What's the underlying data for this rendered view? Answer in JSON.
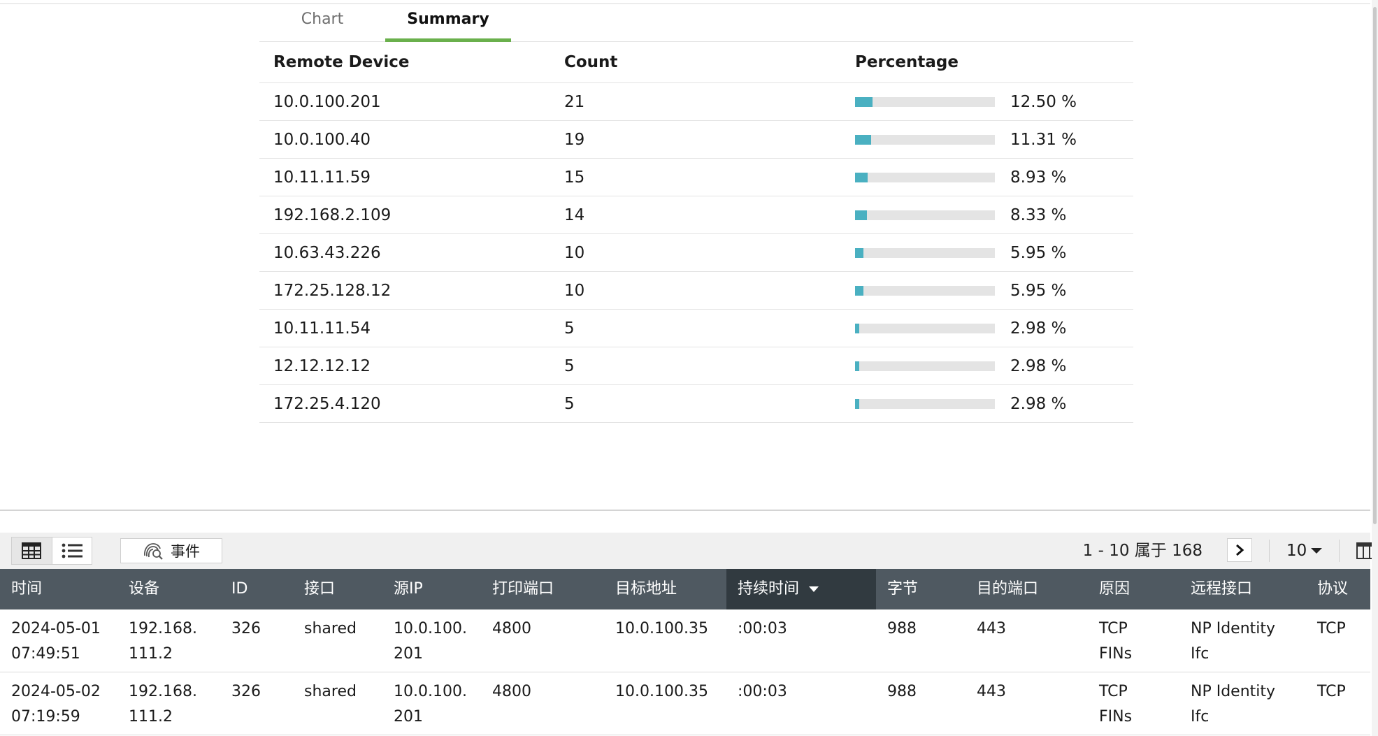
{
  "tabs": [
    {
      "label": "Chart",
      "active": false
    },
    {
      "label": "Summary",
      "active": true
    }
  ],
  "summary": {
    "headers": [
      "Remote Device",
      "Count",
      "Percentage"
    ],
    "rows": [
      {
        "device": "10.0.100.201",
        "count": "21",
        "percentage": "12.50 %",
        "pct_value": 12.5
      },
      {
        "device": "10.0.100.40",
        "count": "19",
        "percentage": "11.31 %",
        "pct_value": 11.31
      },
      {
        "device": "10.11.11.59",
        "count": "15",
        "percentage": "8.93 %",
        "pct_value": 8.93
      },
      {
        "device": "192.168.2.109",
        "count": "14",
        "percentage": "8.33 %",
        "pct_value": 8.33
      },
      {
        "device": "10.63.43.226",
        "count": "10",
        "percentage": "5.95 %",
        "pct_value": 5.95
      },
      {
        "device": "172.25.128.12",
        "count": "10",
        "percentage": "5.95 %",
        "pct_value": 5.95
      },
      {
        "device": "10.11.11.54",
        "count": "5",
        "percentage": "2.98 %",
        "pct_value": 2.98
      },
      {
        "device": "12.12.12.12",
        "count": "5",
        "percentage": "2.98 %",
        "pct_value": 2.98
      },
      {
        "device": "172.25.4.120",
        "count": "5",
        "percentage": "2.98 %",
        "pct_value": 2.98
      }
    ],
    "bar_color": "#4ab0c1"
  },
  "toolbar": {
    "event_label": "事件",
    "pager_text": "1 - 10 属于 168",
    "page_size": "10",
    "icons": {
      "grid": "grid-view-icon",
      "list": "list-view-icon",
      "event": "fingerprint-search-icon",
      "next": "chevron-right-icon",
      "columns": "column-chooser-icon"
    }
  },
  "events": {
    "headers": [
      "时间",
      "设备",
      "ID",
      "接口",
      "源IP",
      "打印端口",
      "目标地址",
      "持续时间",
      "字节",
      "目的端口",
      "原因",
      "远程接口",
      "协议"
    ],
    "sorted_column": "持续时间",
    "header_bg": "#4f5961",
    "rows": [
      {
        "time": "2024-05-01\n07:49:51",
        "device": "192.168.\n111.2",
        "id": "326",
        "interface": "shared",
        "src_ip": "10.0.100.\n201",
        "print_port": "4800",
        "dest": "10.0.100.35",
        "duration": ":00:03",
        "bytes": "988",
        "dest_port": "443",
        "reason": "TCP\nFINs",
        "remote_if": "NP Identity\nIfc",
        "protocol": "TCP"
      },
      {
        "time": "2024-05-02\n07:19:59",
        "device": "192.168.\n111.2",
        "id": "326",
        "interface": "shared",
        "src_ip": "10.0.100.\n201",
        "print_port": "4800",
        "dest": "10.0.100.35",
        "duration": ":00:03",
        "bytes": "988",
        "dest_port": "443",
        "reason": "TCP\nFINs",
        "remote_if": "NP Identity\nIfc",
        "protocol": "TCP"
      }
    ]
  }
}
